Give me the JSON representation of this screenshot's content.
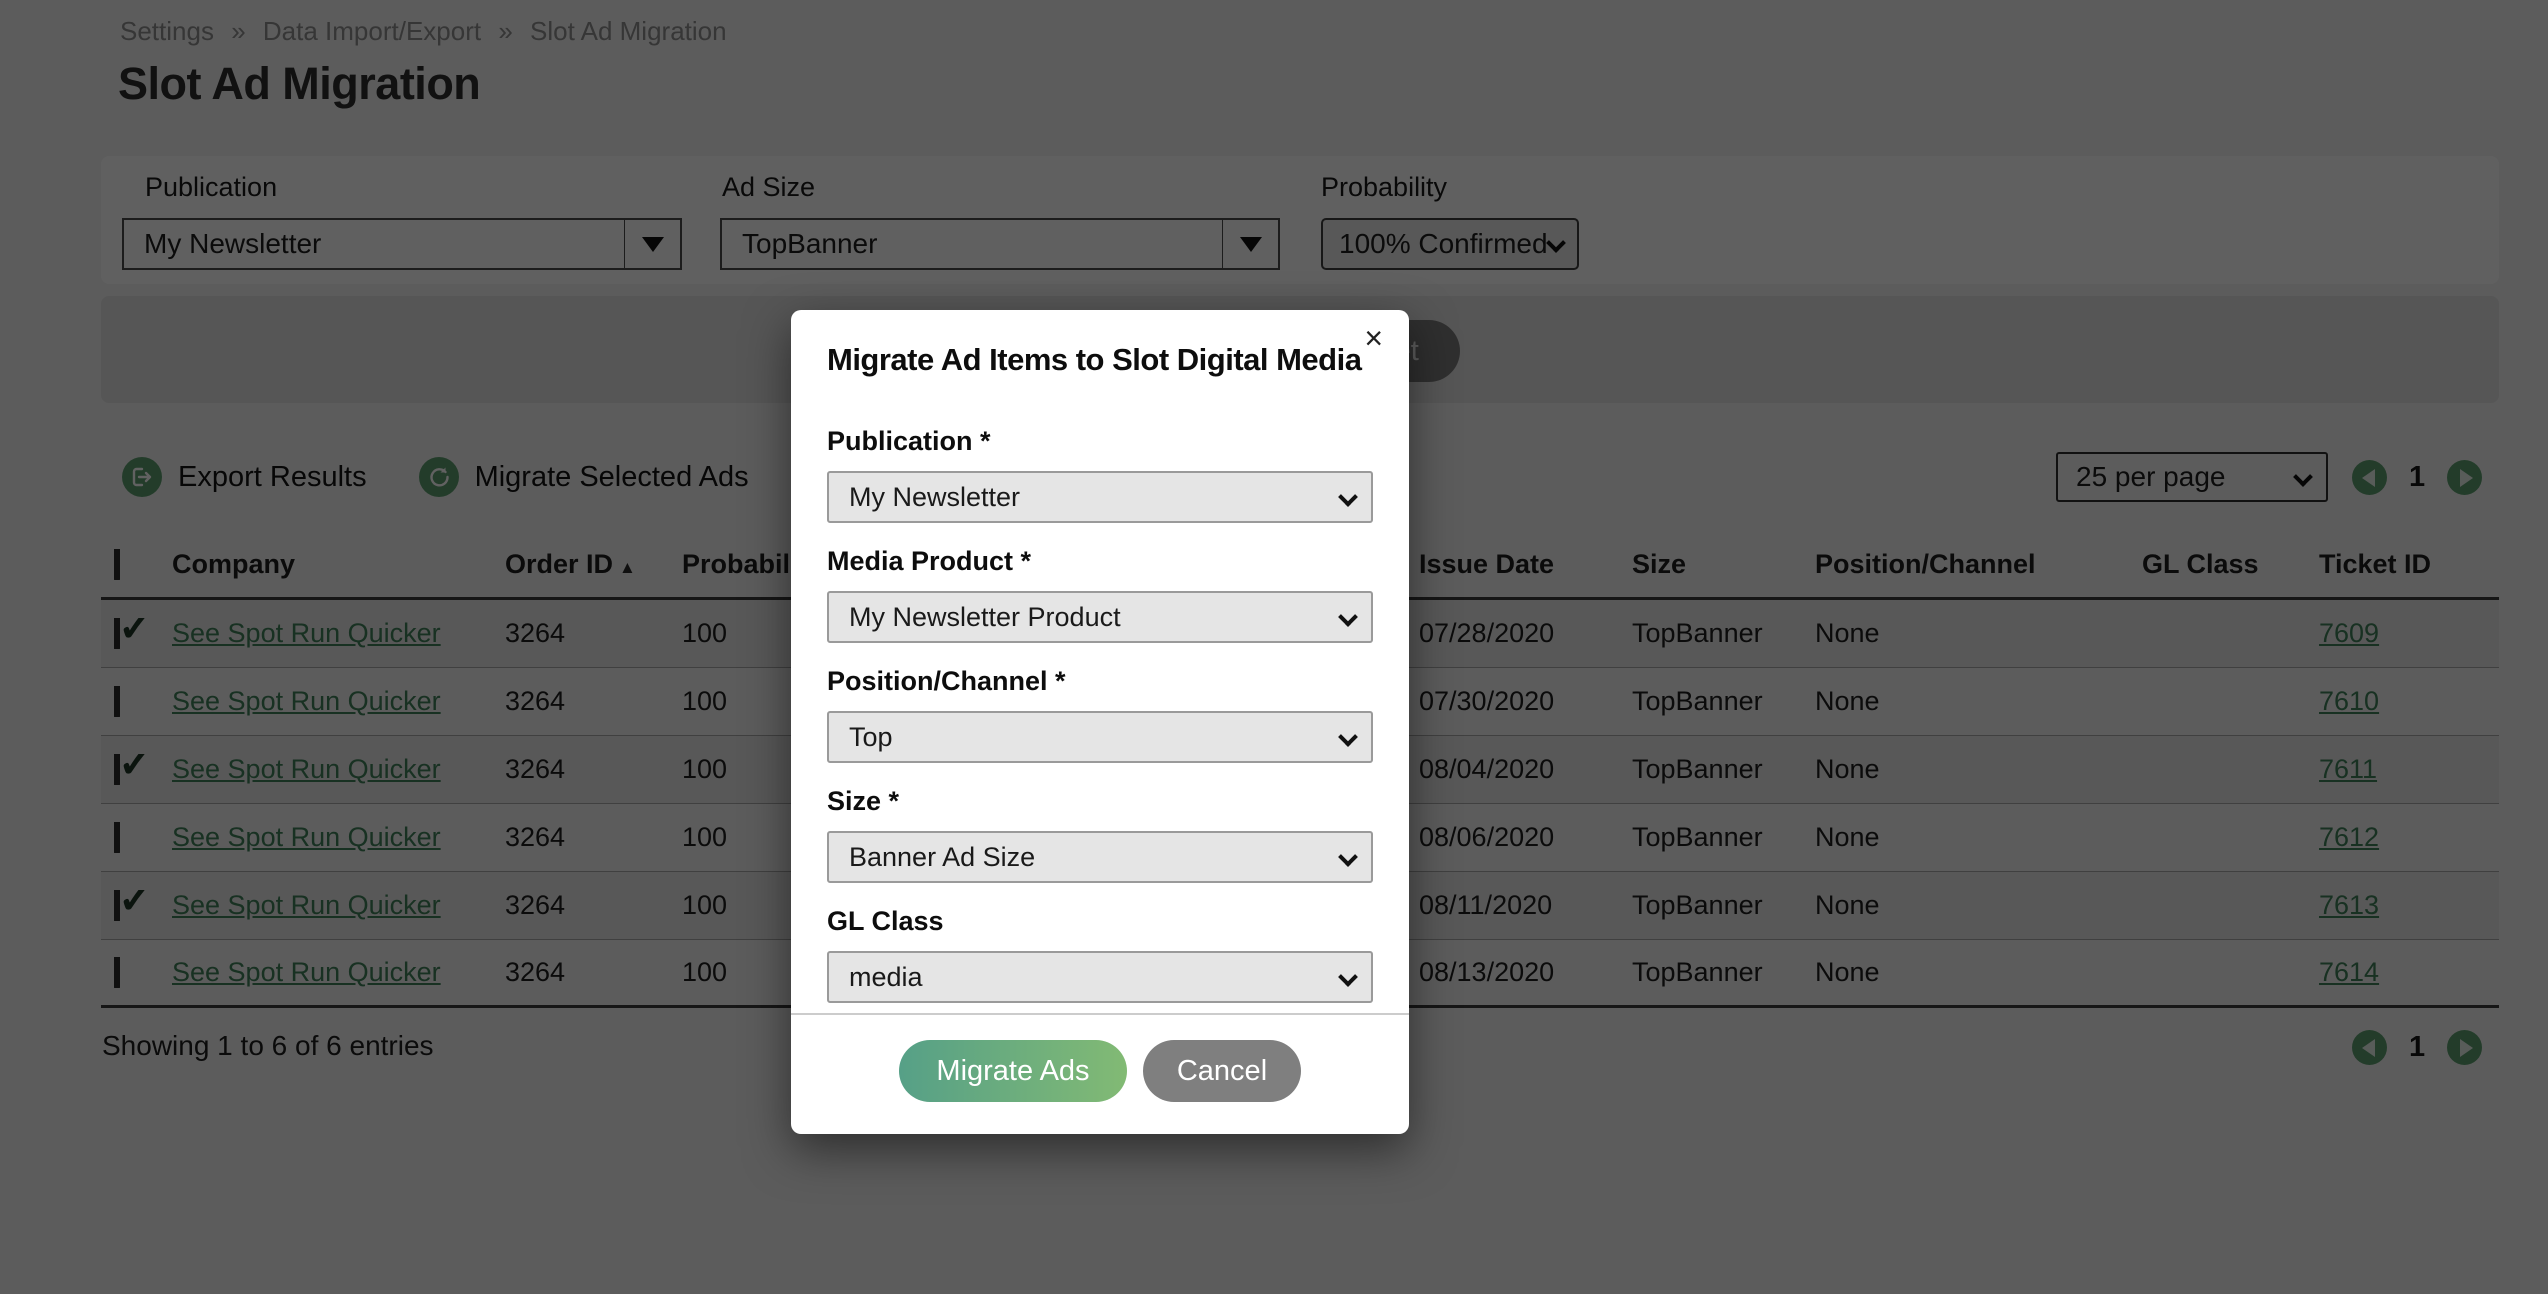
{
  "breadcrumb": {
    "separator": "»",
    "items": [
      "Settings",
      "Data Import/Export",
      "Slot Ad Migration"
    ]
  },
  "page": {
    "title": "Slot Ad Migration"
  },
  "filters": {
    "publication": {
      "label": "Publication",
      "value": "My Newsletter"
    },
    "ad_size": {
      "label": "Ad Size",
      "value": "TopBanner"
    },
    "probability": {
      "label": "Probability",
      "value": "100% Confirmed"
    }
  },
  "filter_actions": {
    "reset_label": "Reset"
  },
  "toolbar": {
    "export_label": "Export Results",
    "migrate_label": "Migrate Selected Ads"
  },
  "pagination": {
    "per_page": "25 per page",
    "page": "1"
  },
  "table": {
    "headers": [
      {
        "label": ""
      },
      {
        "label": "Company"
      },
      {
        "label": "Order ID",
        "sort": "▲"
      },
      {
        "label": "Probability"
      },
      {
        "label": "Issue Date"
      },
      {
        "label": "Size"
      },
      {
        "label": "Position/Channel"
      },
      {
        "label": "GL Class"
      },
      {
        "label": "Ticket ID"
      }
    ],
    "rows": [
      {
        "checked": true,
        "company": "See Spot Run Quicker",
        "order_id": "3264",
        "probability": "100",
        "issue_date": "07/28/2020",
        "size": "TopBanner",
        "position": "None",
        "gl_class": "",
        "ticket_id": "7609"
      },
      {
        "checked": false,
        "company": "See Spot Run Quicker",
        "order_id": "3264",
        "probability": "100",
        "issue_date": "07/30/2020",
        "size": "TopBanner",
        "position": "None",
        "gl_class": "",
        "ticket_id": "7610"
      },
      {
        "checked": true,
        "company": "See Spot Run Quicker",
        "order_id": "3264",
        "probability": "100",
        "issue_date": "08/04/2020",
        "size": "TopBanner",
        "position": "None",
        "gl_class": "",
        "ticket_id": "7611"
      },
      {
        "checked": false,
        "company": "See Spot Run Quicker",
        "order_id": "3264",
        "probability": "100",
        "issue_date": "08/06/2020",
        "size": "TopBanner",
        "position": "None",
        "gl_class": "",
        "ticket_id": "7612"
      },
      {
        "checked": true,
        "company": "See Spot Run Quicker",
        "order_id": "3264",
        "probability": "100",
        "issue_date": "08/11/2020",
        "size": "TopBanner",
        "position": "None",
        "gl_class": "",
        "ticket_id": "7613"
      },
      {
        "checked": false,
        "company": "See Spot Run Quicker",
        "order_id": "3264",
        "probability": "100",
        "issue_date": "08/13/2020",
        "size": "TopBanner",
        "position": "None",
        "gl_class": "",
        "ticket_id": "7614"
      }
    ],
    "footer": "Showing 1 to 6 of 6 entries"
  },
  "modal": {
    "title": "Migrate Ad Items to Slot Digital Media",
    "close": "×",
    "fields": [
      {
        "label": "Publication *",
        "value": "My Newsletter"
      },
      {
        "label": "Media Product *",
        "value": "My Newsletter Product"
      },
      {
        "label": "Position/Channel *",
        "value": "Top"
      },
      {
        "label": "Size *",
        "value": "Banner Ad Size"
      },
      {
        "label": "GL Class",
        "value": "media"
      }
    ],
    "submit_label": "Migrate Ads",
    "cancel_label": "Cancel"
  },
  "icons": {
    "export": "box-arrow-export",
    "migrate": "circular-arrow",
    "prev": "left-triangle",
    "next": "right-triangle",
    "sort": "up-triangle",
    "select": "chevron-down"
  },
  "colors": {
    "accent_green": "#5d9f70",
    "link_green": "#41805a",
    "migrate_gradient_start": "#56a087",
    "migrate_gradient_end": "#82ba74",
    "cancel_gray": "#7f7f7f"
  }
}
